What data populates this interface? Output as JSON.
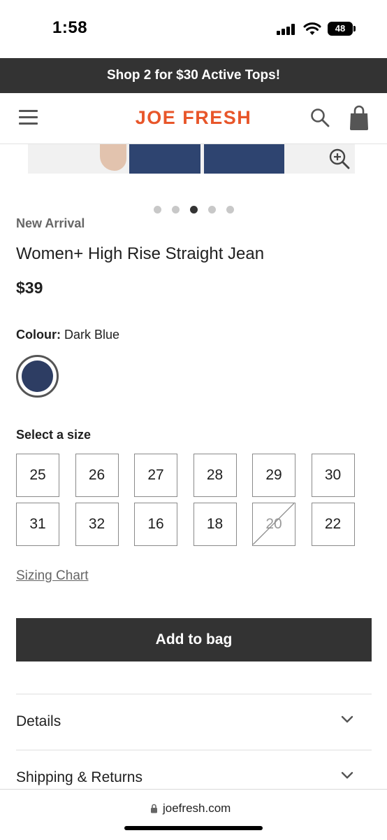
{
  "status_bar": {
    "time": "1:58",
    "battery": "48",
    "icons": [
      "signal-icon",
      "wifi-icon",
      "battery-icon"
    ]
  },
  "promo": {
    "text": "Shop 2 for $30 Active Tops!"
  },
  "header": {
    "logo": "JOE FRESH",
    "icons": [
      "menu-icon",
      "search-icon",
      "bag-icon"
    ]
  },
  "gallery": {
    "total_slides": 5,
    "active_slide": 3,
    "zoom_icon": "zoom-in-icon"
  },
  "product": {
    "badge": "New Arrival",
    "title": "Women+ High Rise Straight Jean",
    "price": "$39"
  },
  "colour": {
    "label": "Colour:",
    "value": "Dark Blue",
    "swatch_color": "#2d3d63"
  },
  "sizes": {
    "label": "Select a size",
    "options": [
      {
        "label": "25",
        "available": true
      },
      {
        "label": "26",
        "available": true
      },
      {
        "label": "27",
        "available": true
      },
      {
        "label": "28",
        "available": true
      },
      {
        "label": "29",
        "available": true
      },
      {
        "label": "30",
        "available": true
      },
      {
        "label": "31",
        "available": true
      },
      {
        "label": "32",
        "available": true
      },
      {
        "label": "16",
        "available": true
      },
      {
        "label": "18",
        "available": true
      },
      {
        "label": "20",
        "available": false
      },
      {
        "label": "22",
        "available": true
      }
    ]
  },
  "sizing_chart": {
    "label": "Sizing Chart"
  },
  "add_to_bag": {
    "label": "Add to bag"
  },
  "accordions": [
    {
      "label": "Details"
    },
    {
      "label": "Shipping & Returns"
    }
  ],
  "browser": {
    "url": "joefresh.com"
  },
  "colors": {
    "brand": "#e8562a",
    "dark": "#333333"
  }
}
